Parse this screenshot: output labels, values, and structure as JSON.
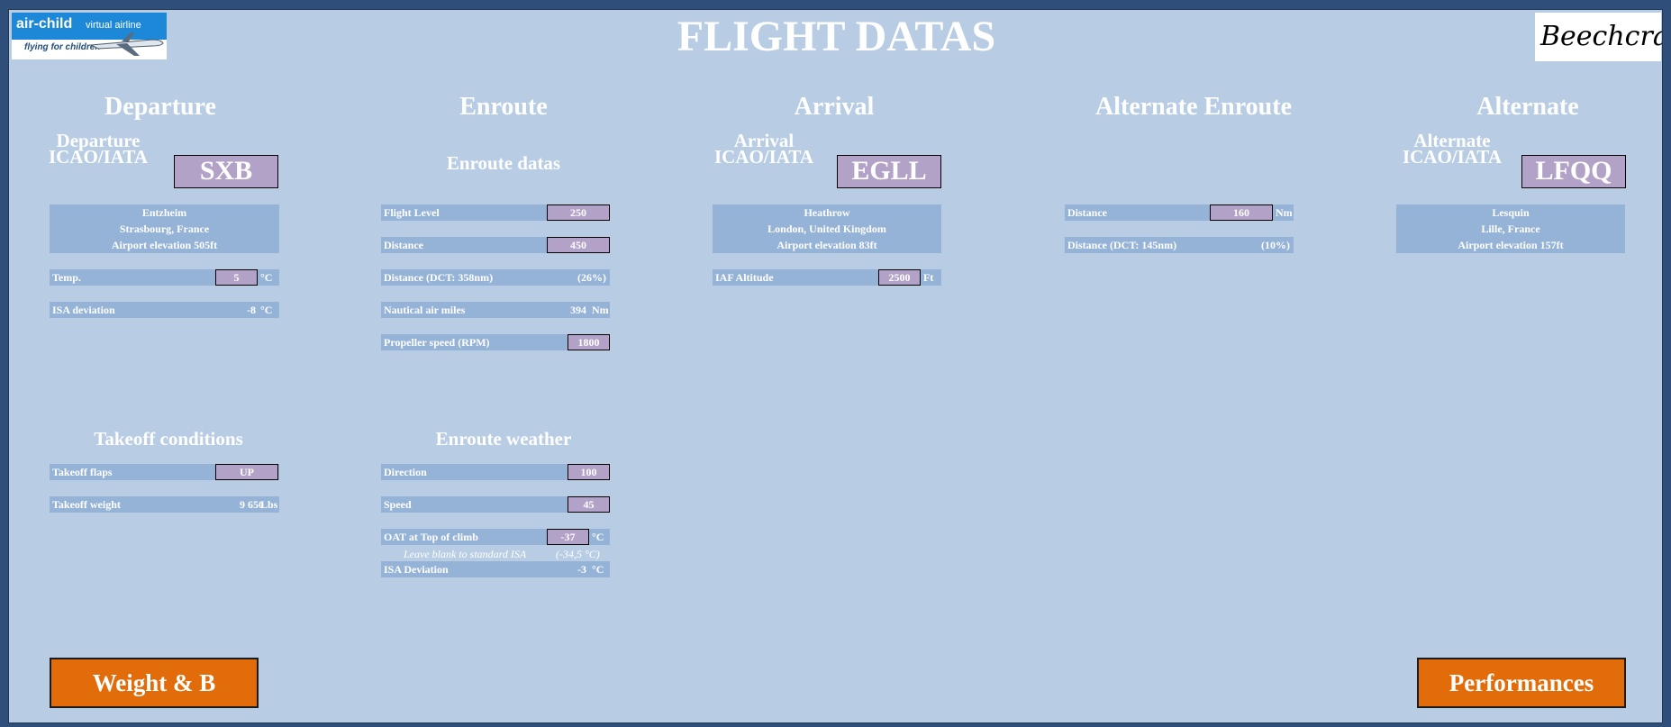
{
  "page": {
    "title": "FLIGHT DATAS"
  },
  "logos": {
    "left": {
      "brand": "air-child",
      "tagline1": "virtual airline",
      "tagline2": "flying for children"
    },
    "right": {
      "brand": "Beechcraft"
    }
  },
  "departure": {
    "heading": "Departure",
    "icao_label_1": "Departure",
    "icao_label_2": "ICAO/IATA",
    "code": "SXB",
    "airport": "Entzheim",
    "city": "Strasbourg, France",
    "elevation": "Airport elevation 505ft",
    "temp_label": "Temp.",
    "temp_value": "5",
    "temp_unit": "°C",
    "isa_label": "ISA deviation",
    "isa_value": "-8",
    "isa_unit": "°C"
  },
  "enroute": {
    "heading": "Enroute",
    "sub": "Enroute datas",
    "rows": [
      {
        "label": "Flight Level",
        "value": "250"
      },
      {
        "label": "Distance",
        "value": "450"
      },
      {
        "label": "Distance (DCT: 358nm)",
        "value": "(26%)"
      },
      {
        "label": "Nautical air miles",
        "value": "394",
        "unit": "Nm"
      },
      {
        "label": "Propeller speed (RPM)",
        "value": "1800"
      }
    ]
  },
  "arrival": {
    "heading": "Arrival",
    "icao_label_1": "Arrival",
    "icao_label_2": "ICAO/IATA",
    "code": "EGLL",
    "airport": "Heathrow",
    "city": "London, United Kingdom",
    "elevation": "Airport elevation 83ft",
    "iaf_label": "IAF Altitude",
    "iaf_value": "2500",
    "iaf_unit": "Ft"
  },
  "alternate_enroute": {
    "heading": "Alternate Enroute",
    "distance_label": "Distance",
    "distance_value": "160",
    "distance_unit": "Nm",
    "dct_label": "Distance (DCT: 145nm)",
    "dct_value": "(10%)"
  },
  "alternate": {
    "heading": "Alternate",
    "icao_label_1": "Alternate",
    "icao_label_2": "ICAO/IATA",
    "code": "LFQQ",
    "airport": "Lesquin",
    "city": "Lille, France",
    "elevation": "Airport elevation 157ft"
  },
  "takeoff": {
    "heading": "Takeoff conditions",
    "flaps_label": "Takeoff flaps",
    "flaps_value": "UP",
    "weight_label": "Takeoff weight",
    "weight_value": "9 650",
    "weight_unit": "Lbs"
  },
  "enroute_weather": {
    "heading": "Enroute weather",
    "direction_label": "Direction",
    "direction_value": "100",
    "speed_label": "Speed",
    "speed_value": "45",
    "oat_label": "OAT at Top of climb",
    "oat_value": "-37",
    "oat_unit": "°C",
    "note": "Leave blank to standard ISA",
    "note_value": "(-34,5 °C)",
    "isa_label": "ISA Deviation",
    "isa_value": "-3",
    "isa_unit": "°C"
  },
  "buttons": {
    "weight": "Weight & B",
    "performances": "Performances"
  },
  "colors": {
    "sheet": "#b8cce4",
    "row": "#95b3d7",
    "input": "#b3a2c7",
    "button": "#e36c0a",
    "frame": "#2f4f7a"
  }
}
